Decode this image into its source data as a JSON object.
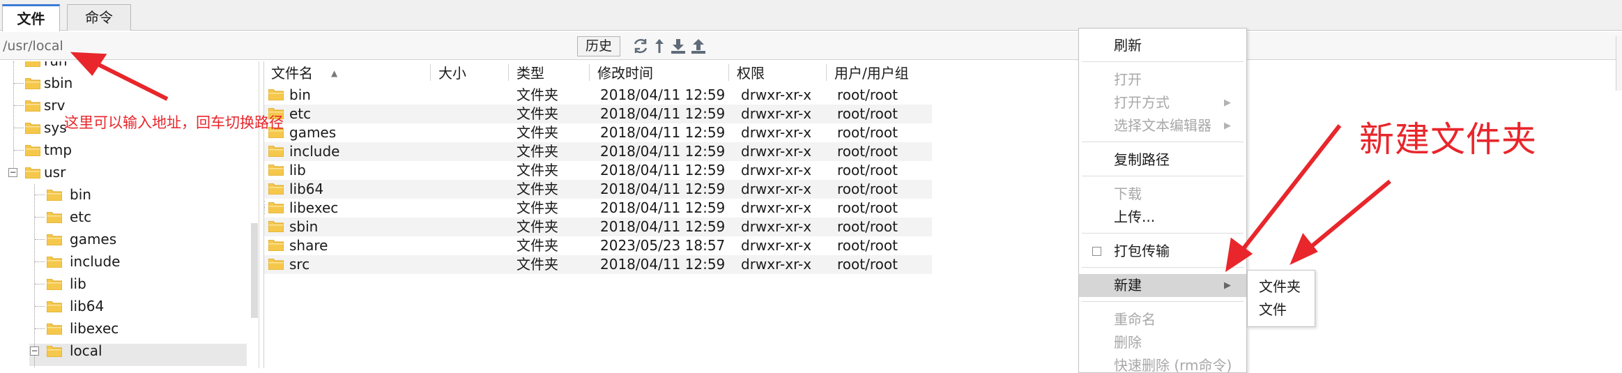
{
  "tabs": [
    {
      "label": "文件",
      "active": true
    },
    {
      "label": "命令",
      "active": false
    }
  ],
  "path_bar": {
    "value": "/usr/local",
    "history_label": "历史",
    "toolbar_icons": [
      "refresh-icon",
      "up-arrow-icon",
      "download-icon",
      "upload-icon"
    ]
  },
  "tree": {
    "items": [
      {
        "label": "run",
        "level": 1
      },
      {
        "label": "sbin",
        "level": 1
      },
      {
        "label": "srv",
        "level": 1
      },
      {
        "label": "sys",
        "level": 1
      },
      {
        "label": "tmp",
        "level": 1
      },
      {
        "label": "usr",
        "level": 1,
        "expanded": true
      },
      {
        "label": "bin",
        "level": 2
      },
      {
        "label": "etc",
        "level": 2
      },
      {
        "label": "games",
        "level": 2
      },
      {
        "label": "include",
        "level": 2
      },
      {
        "label": "lib",
        "level": 2
      },
      {
        "label": "lib64",
        "level": 2
      },
      {
        "label": "libexec",
        "level": 2
      },
      {
        "label": "local",
        "level": 2,
        "expanded": true,
        "selected": true
      }
    ]
  },
  "file_list": {
    "columns": [
      "文件名",
      "大小",
      "类型",
      "修改时间",
      "权限",
      "用户/用户组"
    ],
    "rows": [
      {
        "name": "bin",
        "size": "",
        "type": "文件夹",
        "modified": "2018/04/11 12:59",
        "perm": "drwxr-xr-x",
        "owner": "root/root"
      },
      {
        "name": "etc",
        "size": "",
        "type": "文件夹",
        "modified": "2018/04/11 12:59",
        "perm": "drwxr-xr-x",
        "owner": "root/root"
      },
      {
        "name": "games",
        "size": "",
        "type": "文件夹",
        "modified": "2018/04/11 12:59",
        "perm": "drwxr-xr-x",
        "owner": "root/root"
      },
      {
        "name": "include",
        "size": "",
        "type": "文件夹",
        "modified": "2018/04/11 12:59",
        "perm": "drwxr-xr-x",
        "owner": "root/root"
      },
      {
        "name": "lib",
        "size": "",
        "type": "文件夹",
        "modified": "2018/04/11 12:59",
        "perm": "drwxr-xr-x",
        "owner": "root/root"
      },
      {
        "name": "lib64",
        "size": "",
        "type": "文件夹",
        "modified": "2018/04/11 12:59",
        "perm": "drwxr-xr-x",
        "owner": "root/root"
      },
      {
        "name": "libexec",
        "size": "",
        "type": "文件夹",
        "modified": "2018/04/11 12:59",
        "perm": "drwxr-xr-x",
        "owner": "root/root"
      },
      {
        "name": "sbin",
        "size": "",
        "type": "文件夹",
        "modified": "2018/04/11 12:59",
        "perm": "drwxr-xr-x",
        "owner": "root/root"
      },
      {
        "name": "share",
        "size": "",
        "type": "文件夹",
        "modified": "2023/05/23 18:57",
        "perm": "drwxr-xr-x",
        "owner": "root/root"
      },
      {
        "name": "src",
        "size": "",
        "type": "文件夹",
        "modified": "2018/04/11 12:59",
        "perm": "drwxr-xr-x",
        "owner": "root/root"
      }
    ]
  },
  "context_menu": {
    "items": [
      {
        "label": "刷新",
        "enabled": true
      },
      {
        "label": "打开",
        "enabled": false
      },
      {
        "label": "打开方式",
        "enabled": false,
        "submenu": true
      },
      {
        "label": "选择文本编辑器",
        "enabled": false,
        "submenu": true
      },
      {
        "label": "复制路径",
        "enabled": true
      },
      {
        "label": "下载",
        "enabled": false
      },
      {
        "label": "上传...",
        "enabled": true
      },
      {
        "label": "打包传输",
        "enabled": true,
        "checkbox": true,
        "checked": false
      },
      {
        "label": "新建",
        "enabled": true,
        "submenu": true,
        "highlighted": true
      },
      {
        "label": "重命名",
        "enabled": false
      },
      {
        "label": "删除",
        "enabled": false
      },
      {
        "label": "快速删除 (rm命令)",
        "enabled": false
      }
    ],
    "new_submenu": [
      "文件夹",
      "文件"
    ]
  },
  "annotations": {
    "path_hint": "这里可以输入地址，回车切换路径",
    "new_folder_hint": "新建文件夹",
    "color": "#e8262b"
  },
  "colors": {
    "folder": "#f5c84c",
    "folder_dark": "#d9a521",
    "active_tab_accent": "#3b7bd6",
    "row_alt": "#f3f3f3",
    "menu_highlight": "#d6d6d6"
  }
}
